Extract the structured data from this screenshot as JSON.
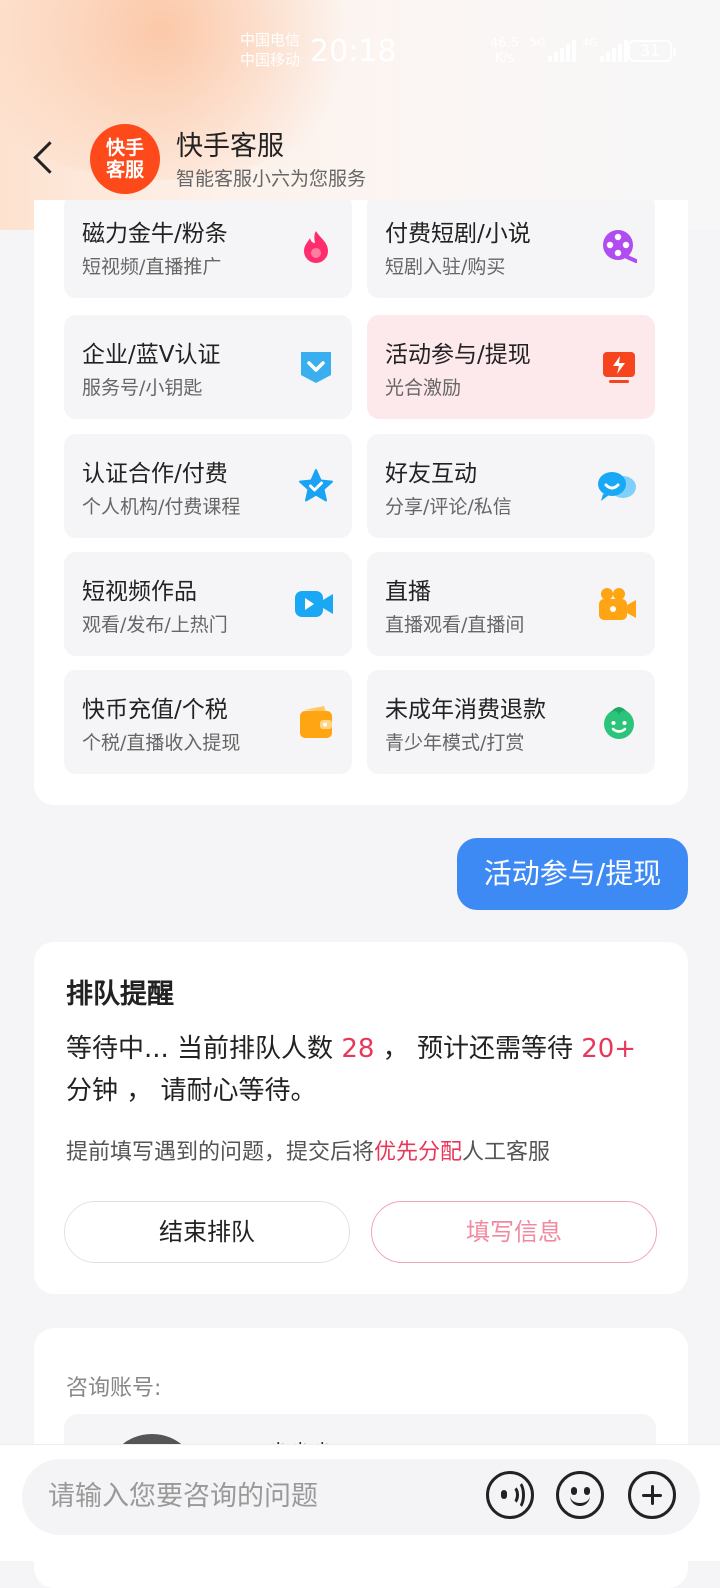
{
  "status_bar": {
    "carrier_1": "中国电信",
    "carrier_2": "中国移动",
    "time": "20:18",
    "net_speed_value": "46.5",
    "net_speed_unit": "K/s",
    "signal_1_label": "5G",
    "signal_2_label": "4G",
    "battery": "31"
  },
  "header": {
    "logo_line_1": "快手",
    "logo_line_2": "客服",
    "title": "快手客服",
    "subtitle": "智能客服小六为您服务"
  },
  "menu": {
    "items": [
      {
        "title": "磁力金牛/粉条",
        "subtitle": "短视频/直播推广",
        "icon": "flame-icon",
        "color": "#ff2d6e"
      },
      {
        "title": "付费短剧/小说",
        "subtitle": "短剧入驻/购买",
        "icon": "film-reel-icon",
        "color": "#b04cf0"
      },
      {
        "title": "企业/蓝V认证",
        "subtitle": "服务号/小钥匙",
        "icon": "blue-v-badge-icon",
        "color": "#3aaff0"
      },
      {
        "title": "活动参与/提现",
        "subtitle": "光合激励",
        "icon": "lightning-screen-icon",
        "color": "#f5441e"
      },
      {
        "title": "认证合作/付费",
        "subtitle": "个人机构/付费课程",
        "icon": "star-check-icon",
        "color": "#1aa3f5"
      },
      {
        "title": "好友互动",
        "subtitle": "分享/评论/私信",
        "icon": "chat-bubbles-icon",
        "color": "#18a8f5"
      },
      {
        "title": "短视频作品",
        "subtitle": "观看/发布/上热门",
        "icon": "video-camera-icon",
        "color": "#1aa8f5"
      },
      {
        "title": "直播",
        "subtitle": "直播观看/直播间",
        "icon": "movie-camera-icon",
        "color": "#ffa514"
      },
      {
        "title": "快币充值/个税",
        "subtitle": "个税/直播收入提现",
        "icon": "wallet-icon",
        "color": "#ffa514"
      },
      {
        "title": "未成年消费退款",
        "subtitle": "青少年模式/打赏",
        "icon": "child-face-icon",
        "color": "#2bc47a"
      }
    ]
  },
  "chat": {
    "user_message": "活动参与/提现"
  },
  "queue": {
    "title": "排队提醒",
    "text_prefix": "等待中... 当前排队人数 ",
    "count": "28",
    "text_middle": " ， 预计还需等待 ",
    "wait": "20+",
    "text_suffix": " 分钟 ， 请耐心等待。",
    "tip_prefix": "提前填写遇到的问题，提交后将",
    "tip_highlight": "优先分配",
    "tip_suffix": "人工客服",
    "end_button": "结束排队",
    "fill_button": "填写信息"
  },
  "account": {
    "label": "咨询账号:",
    "name": "咪咪咪"
  },
  "input_bar": {
    "placeholder": "请输入您要咨询的问题"
  }
}
